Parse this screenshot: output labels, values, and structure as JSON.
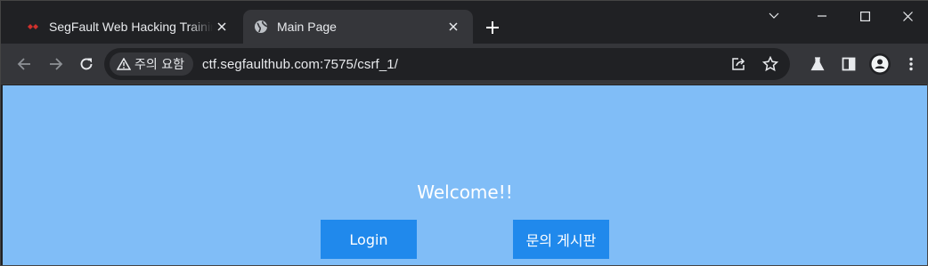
{
  "browser": {
    "tabs": [
      {
        "title": "SegFault Web Hacking Training",
        "favicon": "segfault-logo",
        "active": false
      },
      {
        "title": "Main Page",
        "favicon": "globe-icon",
        "active": true
      }
    ],
    "security_label": "주의 요함",
    "url": "ctf.segfaulthub.com:7575/csrf_1/"
  },
  "page": {
    "welcome": "Welcome!!",
    "login_label": "Login",
    "board_label": "문의 게시판"
  },
  "colors": {
    "page_background": "#80bdf7",
    "button_background": "#2089ec",
    "tab_active": "#35363a",
    "tab_strip": "#202124"
  }
}
